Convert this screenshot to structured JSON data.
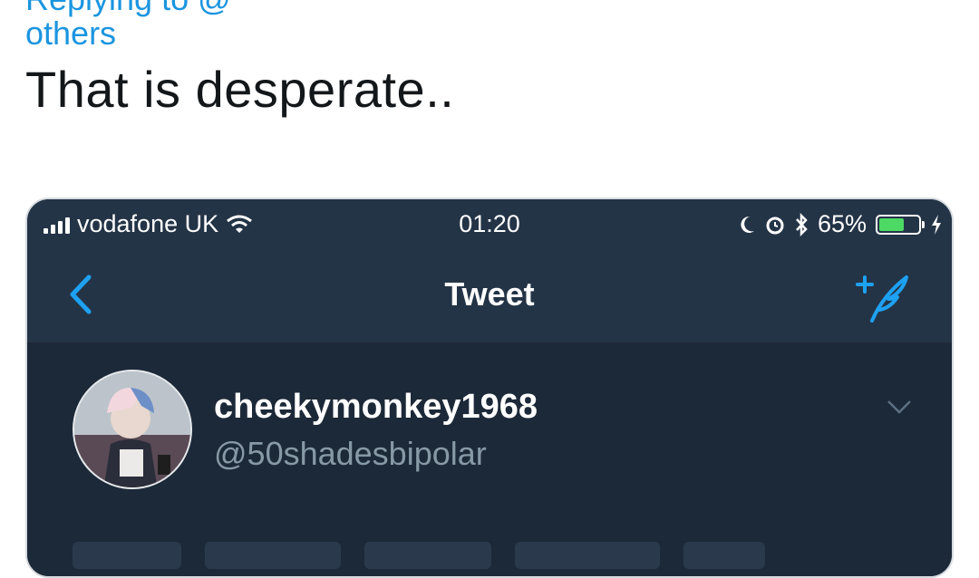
{
  "tweet": {
    "reply_prefix": "Replying to @",
    "reply_more": "others",
    "text": "That is desperate.."
  },
  "phone": {
    "status": {
      "carrier": "vodafone UK",
      "time": "01:20",
      "battery_percent": "65%",
      "battery_level": 0.65
    },
    "nav": {
      "title": "Tweet",
      "back_icon": "chevron-left-icon",
      "compose_icon": "compose-tweet-icon"
    },
    "author": {
      "display_name": "cheekymonkey1968",
      "handle": "@50shadesbipolar"
    }
  },
  "colors": {
    "link": "#1b95e0",
    "nav_bg": "#243447",
    "content_bg": "#1c2938",
    "accent": "#1da1f2",
    "battery": "#4cd964"
  }
}
